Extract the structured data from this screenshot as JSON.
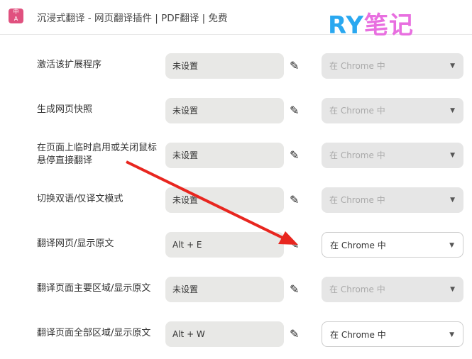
{
  "header": {
    "logo_text": "中A",
    "title": "沉浸式翻译 - 网页翻译插件 | PDF翻译 | 免费",
    "watermark": "RY笔记"
  },
  "rows": [
    {
      "label": "激活该扩展程序",
      "shortcut": "未设置",
      "scope": "在 Chrome 中",
      "enabled": false
    },
    {
      "label": "生成网页快照",
      "shortcut": "未设置",
      "scope": "在 Chrome 中",
      "enabled": false
    },
    {
      "label": "在页面上临时启用或关闭鼠标悬停直接翻译",
      "shortcut": "未设置",
      "scope": "在 Chrome 中",
      "enabled": false
    },
    {
      "label": "切换双语/仅译文模式",
      "shortcut": "未设置",
      "scope": "在 Chrome 中",
      "enabled": false
    },
    {
      "label": "翻译网页/显示原文",
      "shortcut": "Alt + E",
      "scope": "在 Chrome 中",
      "enabled": true
    },
    {
      "label": "翻译页面主要区域/显示原文",
      "shortcut": "未设置",
      "scope": "在 Chrome 中",
      "enabled": false
    },
    {
      "label": "翻译页面全部区域/显示原文",
      "shortcut": "Alt + W",
      "scope": "在 Chrome 中",
      "enabled": true
    }
  ],
  "colors": {
    "arrow": "#e8261f",
    "logo": "#e0517f"
  }
}
